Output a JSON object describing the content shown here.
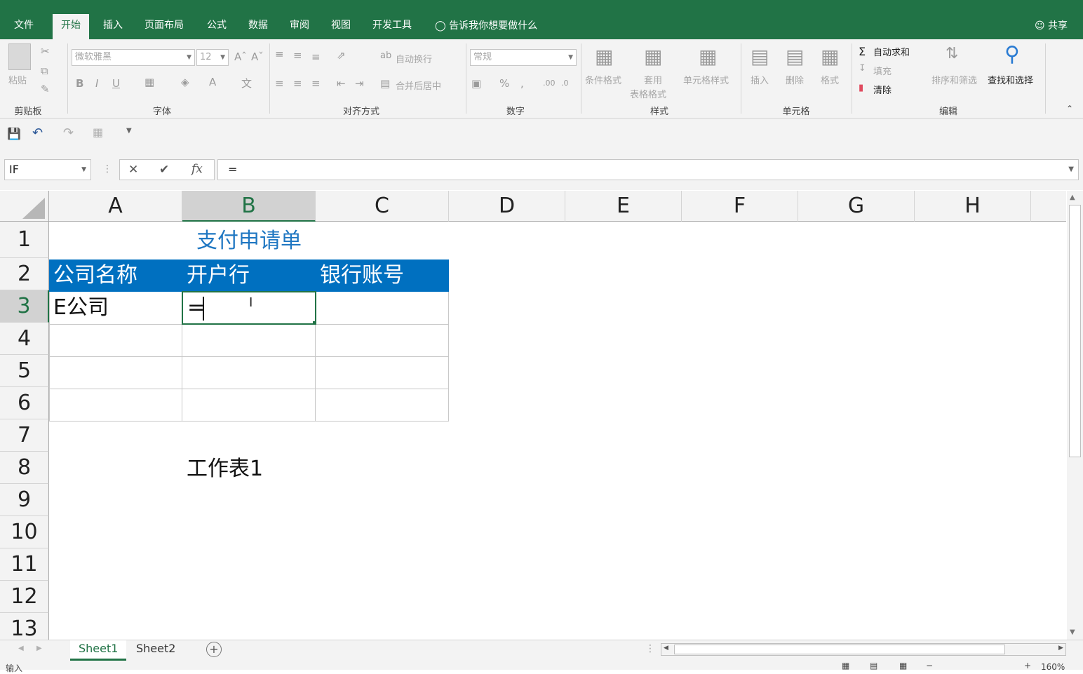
{
  "tabs": [
    "文件",
    "开始",
    "插入",
    "页面布局",
    "公式",
    "数据",
    "审阅",
    "视图",
    "开发工具"
  ],
  "active_tab": "开始",
  "tell_me": "告诉我你想要做什么",
  "share": "共享",
  "ribbon": {
    "clipboard": {
      "paste": "粘贴",
      "label": "剪贴板"
    },
    "font": {
      "name": "微软雅黑",
      "size": "12",
      "label": "字体"
    },
    "alignment": {
      "wrap": "自动换行",
      "merge": "合并后居中",
      "label": "对齐方式"
    },
    "number": {
      "format": "常规",
      "label": "数字"
    },
    "styles": {
      "cond": "条件格式",
      "table1": "套用",
      "table2": "表格格式",
      "cell": "单元格样式",
      "label": "样式"
    },
    "cells": {
      "insert": "插入",
      "delete": "删除",
      "format": "格式",
      "label": "单元格"
    },
    "editing": {
      "autosum": "自动求和",
      "fill": "填充",
      "clear": "清除",
      "sort": "排序和筛选",
      "find": "查找和选择",
      "label": "编辑"
    }
  },
  "name_box": "IF",
  "formula": "=",
  "columns": [
    "A",
    "B",
    "C",
    "D",
    "E",
    "F",
    "G",
    "H"
  ],
  "rows": [
    "1",
    "2",
    "3",
    "4",
    "5",
    "6",
    "7",
    "8",
    "9",
    "10",
    "11",
    "12",
    "13"
  ],
  "cells": {
    "title": "支付申请单",
    "h1": "公司名称",
    "h2": "开户行",
    "h3": "银行账号",
    "a3": "E公司",
    "b3": "=",
    "b8": "工作表1"
  },
  "sheets": [
    "Sheet1",
    "Sheet2"
  ],
  "active_sheet": "Sheet1",
  "status": "输入",
  "zoom": "160%",
  "colors": {
    "excel_green": "#217346",
    "header_blue": "#0070c0",
    "title_blue": "#1f77c2"
  }
}
